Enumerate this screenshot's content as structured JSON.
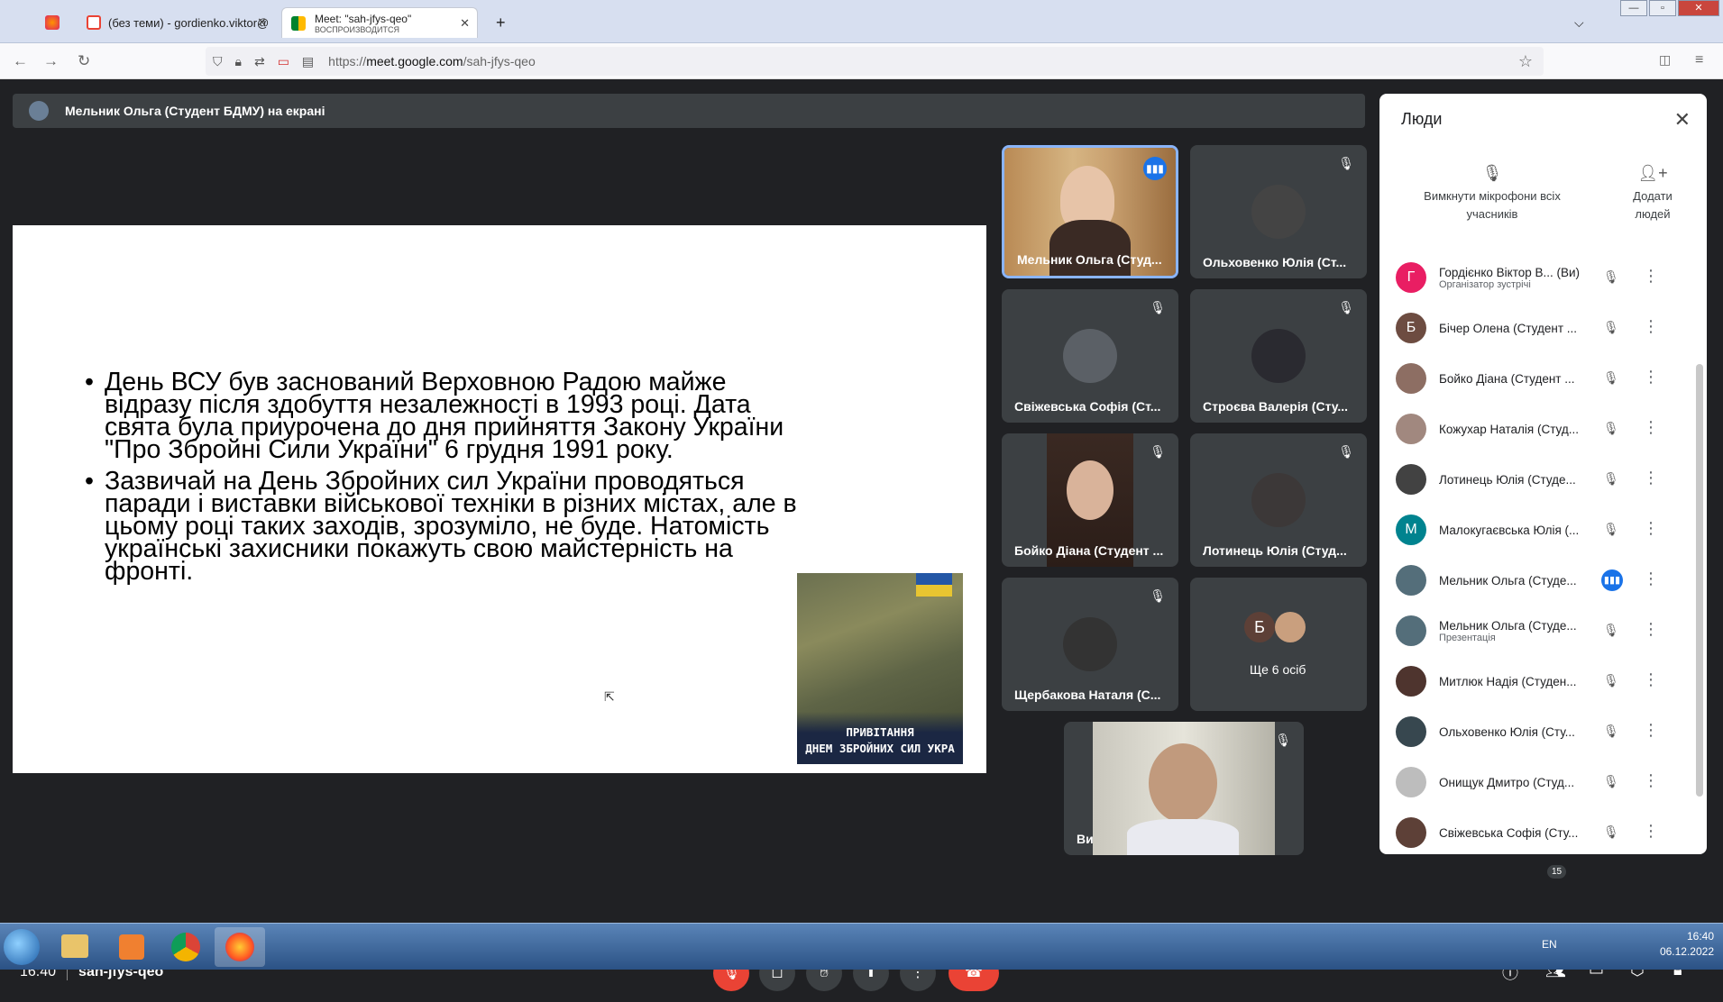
{
  "browser": {
    "tabs": [
      {
        "label": "(без теми) - gordienko.viktor@",
        "icon": "gmail-icon"
      },
      {
        "label": "Meet: \"sah-jfys-qeo\"",
        "sublabel": "ВОСПРОИЗВОДИТСЯ",
        "icon": "meet-icon"
      }
    ],
    "new_tab": "+",
    "url_prefix": "https://",
    "url_host": "meet.google.com",
    "url_path": "/sah-jfys-qeo"
  },
  "meet": {
    "presenting_banner": "Мельник Ольга (Студент БДМУ) на екрані",
    "slide": {
      "bullets": [
        "День ВСУ був заснований Верховною Радою майже відразу після здобуття незалежності в 1993 році. Дата свята була приурочена до дня прийняття Закону України \"Про Збройні Сили України\" 6 грудня 1991 року.",
        "Зазвичай на День Збройних сил України проводяться паради і виставки військової техніки в різних містах, але в цьому році таких заходів, зрозуміло, не буде. Натомість українські захисники покажуть свою майстерність на фронті."
      ],
      "image_caption_1": "ПРИВІТАННЯ",
      "image_caption_2": "ДНЕМ ЗБРОЙНИХ СИЛ УКРА"
    },
    "tiles": [
      {
        "name": "Мельник Ольга (Студ...",
        "speaking": true
      },
      {
        "name": "Ольховенко Юлія (Ст..."
      },
      {
        "name": "Свіжевська Софія (Ст..."
      },
      {
        "name": "Строєва Валерія (Сту..."
      },
      {
        "name": "Бойко Діана (Студент ..."
      },
      {
        "name": "Лотинець Юлія (Студ..."
      },
      {
        "name": "Щербакова Наталя (С..."
      },
      {
        "name": "Ще 6 осіб",
        "avatar_letter": "Б"
      },
      {
        "name": "Ви"
      }
    ],
    "time": "16:40",
    "meeting_code": "sah-jfys-qeo",
    "participants_count": "15"
  },
  "people_panel": {
    "title": "Люди",
    "mute_all": "Вимкнути мікрофони всіх учасників",
    "add_people": "Додати людей",
    "participants": [
      {
        "letter": "Г",
        "color": "#e91e63",
        "name": "Гордієнко Віктор В... (Ви)",
        "sub": "Організатор зустрічі"
      },
      {
        "letter": "Б",
        "color": "#6d4c41",
        "name": "Бічер Олена (Студент ..."
      },
      {
        "letter": "",
        "color": "#8d6e63",
        "name": "Бойко Діана (Студент ..."
      },
      {
        "letter": "",
        "color": "#a1887f",
        "name": "Кожухар Наталія (Студ..."
      },
      {
        "letter": "",
        "color": "#424242",
        "name": "Лотинець Юлія (Студе..."
      },
      {
        "letter": "М",
        "color": "#00838f",
        "name": "Малокугаєвська Юлія (..."
      },
      {
        "letter": "",
        "color": "#546e7a",
        "name": "Мельник Ольга (Студе...",
        "speaking": true
      },
      {
        "letter": "",
        "color": "#546e7a",
        "name": "Мельник Ольга (Студе...",
        "sub": "Презентація"
      },
      {
        "letter": "",
        "color": "#4e342e",
        "name": "Митлюк Надія (Студен..."
      },
      {
        "letter": "",
        "color": "#37474f",
        "name": "Ольховенко Юлія (Сту..."
      },
      {
        "letter": "",
        "color": "#bdbdbd",
        "name": "Онищук Дмитро (Студ..."
      },
      {
        "letter": "",
        "color": "#5d4037",
        "name": "Свіжевська Софія (Сту..."
      }
    ]
  },
  "taskbar": {
    "lang": "EN",
    "time": "16:40",
    "date": "06.12.2022"
  }
}
